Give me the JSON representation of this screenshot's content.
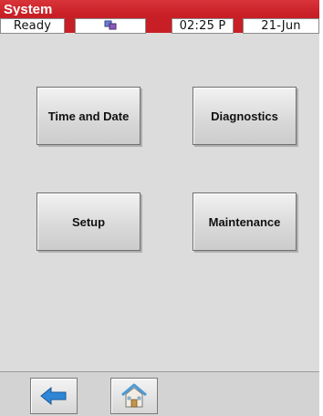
{
  "window": {
    "title": "System"
  },
  "status": {
    "state": "Ready",
    "icon": "network-icon",
    "time": "02:25 P",
    "date": "21-Jun"
  },
  "menu": {
    "buttons": [
      {
        "label": "Time and Date"
      },
      {
        "label": "Diagnostics"
      },
      {
        "label": "Setup"
      },
      {
        "label": "Maintenance"
      }
    ]
  },
  "nav": {
    "back_icon": "back-arrow-icon",
    "home_icon": "home-icon"
  },
  "colors": {
    "title_bar": "#c81e25",
    "background": "#dcdcdc",
    "back_arrow": "#2f86d6"
  }
}
